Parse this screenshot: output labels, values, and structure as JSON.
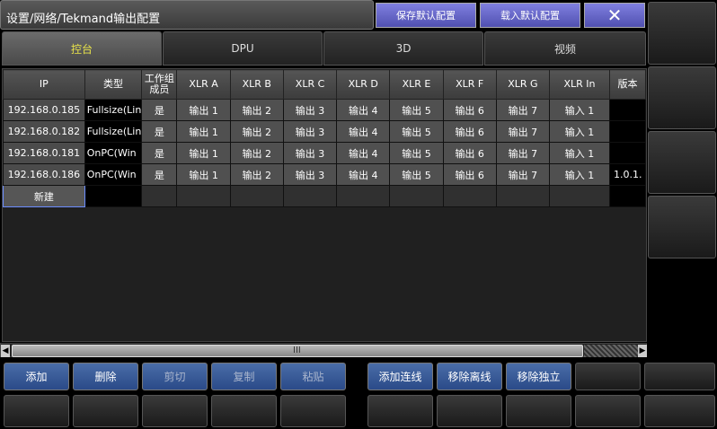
{
  "title": "设置/网络/Tekmand输出配置",
  "top_buttons": {
    "save_default": "保存默认配置",
    "load_default": "载入默认配置",
    "close": "✕"
  },
  "tabs": [
    {
      "label": "控台",
      "active": true
    },
    {
      "label": "DPU",
      "active": false
    },
    {
      "label": "3D",
      "active": false
    },
    {
      "label": "视频",
      "active": false
    }
  ],
  "columns": [
    "IP",
    "类型",
    "工作组成员",
    "XLR A",
    "XLR B",
    "XLR C",
    "XLR D",
    "XLR E",
    "XLR F",
    "XLR G",
    "XLR In",
    "版本"
  ],
  "rows": [
    [
      "192.168.0.185",
      "Fullsize(Lin",
      "是",
      "输出 1",
      "输出 2",
      "输出 3",
      "输出 4",
      "输出 5",
      "输出 6",
      "输出 7",
      "输入 1",
      ""
    ],
    [
      "192.168.0.182",
      "Fullsize(Lin",
      "是",
      "输出 1",
      "输出 2",
      "输出 3",
      "输出 4",
      "输出 5",
      "输出 6",
      "输出 7",
      "输入 1",
      ""
    ],
    [
      "192.168.0.181",
      "OnPC(Win",
      "是",
      "输出 1",
      "输出 2",
      "输出 3",
      "输出 4",
      "输出 5",
      "输出 6",
      "输出 7",
      "输入 1",
      ""
    ],
    [
      "192.168.0.186",
      "OnPC(Win",
      "是",
      "输出 1",
      "输出 2",
      "输出 3",
      "输出 4",
      "输出 5",
      "输出 6",
      "输出 7",
      "输入 1",
      "1.0.1."
    ]
  ],
  "new_row_label": "新建",
  "scroll_grip": "III",
  "bottom_buttons": [
    {
      "label": "添加",
      "enabled": true
    },
    {
      "label": "删除",
      "enabled": true
    },
    {
      "label": "剪切",
      "enabled": false
    },
    {
      "label": "复制",
      "enabled": false
    },
    {
      "label": "粘贴",
      "enabled": false
    },
    {
      "label": "添加连线",
      "enabled": true
    },
    {
      "label": "移除离线",
      "enabled": true
    },
    {
      "label": "移除独立",
      "enabled": true
    }
  ]
}
